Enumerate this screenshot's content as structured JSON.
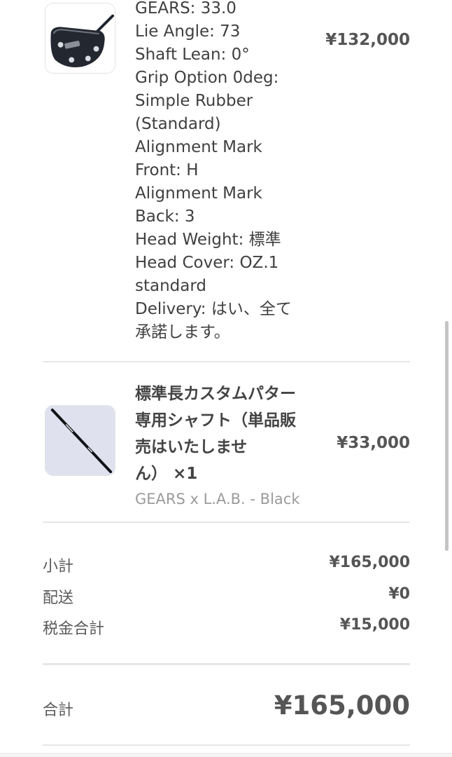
{
  "line_items": [
    {
      "image_icon": "putter-head-image",
      "title": "",
      "properties": [
        "GEARS: 33.0",
        "Lie Angle: 73",
        "Shaft Lean: 0°",
        "Grip Option 0deg:",
        "Simple Rubber",
        "(Standard)",
        "Alignment Mark",
        "Front: H",
        "Alignment Mark",
        "Back: 3",
        "Head Weight: 標準",
        "Head Cover: OZ.1",
        "standard",
        "Delivery: はい、全て",
        "承諾します。"
      ],
      "price": "¥132,000"
    },
    {
      "image_icon": "putter-shaft-image",
      "title_lines": [
        "標準長カスタムパター",
        "専用シャフト（単品販",
        "売はいたしませ",
        "ん） ×1"
      ],
      "variant": "GEARS x L.A.B. - Black",
      "price": "¥33,000"
    }
  ],
  "summary": {
    "subtotal_label": "小計",
    "subtotal_value": "¥165,000",
    "shipping_label": "配送",
    "shipping_value": "¥0",
    "tax_label": "税金合計",
    "tax_value": "¥15,000"
  },
  "total": {
    "label": "合計",
    "value": "¥165,000"
  },
  "colors": {
    "text": "#404040",
    "muted": "#9b9b9b",
    "divider": "#e6e6e6",
    "thumb_bg": "#dfe2ee"
  }
}
